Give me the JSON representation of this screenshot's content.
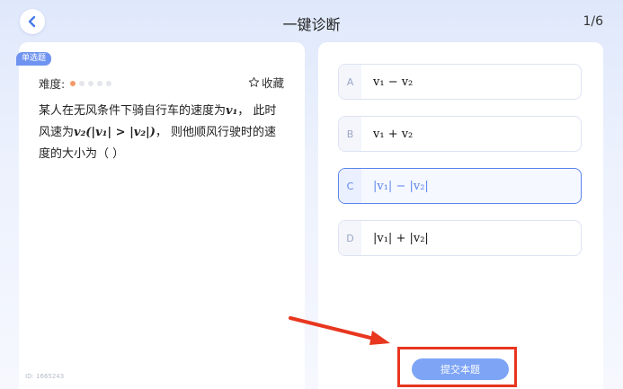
{
  "header": {
    "title": "一键诊断",
    "progress": "1/6"
  },
  "question": {
    "type_tag": "单选题",
    "difficulty_label": "难度:",
    "difficulty_level": 1,
    "difficulty_max": 5,
    "favorite_label": "收藏",
    "line1_text": "某人在无风条件下骑自行车的速度为",
    "line1_math": "v₁",
    "line1_end": "， 此时",
    "line2_text": "风速为",
    "line2_math": "v₂(|v₁| > |v₂|)",
    "line2_end": "， 则他顺风行驶时的速",
    "line3": "度的大小为（      ）",
    "id": "ID: 1665243"
  },
  "options": [
    {
      "letter": "A",
      "text": "v₁ − v₂"
    },
    {
      "letter": "B",
      "text": "v₁ + v₂"
    },
    {
      "letter": "C",
      "text": "|v₁| − |v₂|"
    },
    {
      "letter": "D",
      "text": "|v₁| + |v₂|"
    }
  ],
  "selected_option": "C",
  "submit_label": "提交本题",
  "colors": {
    "accent": "#5b84ec",
    "submit": "#7da4f5",
    "annotation": "#e8361f",
    "difficulty_on": "#f59a6a"
  }
}
